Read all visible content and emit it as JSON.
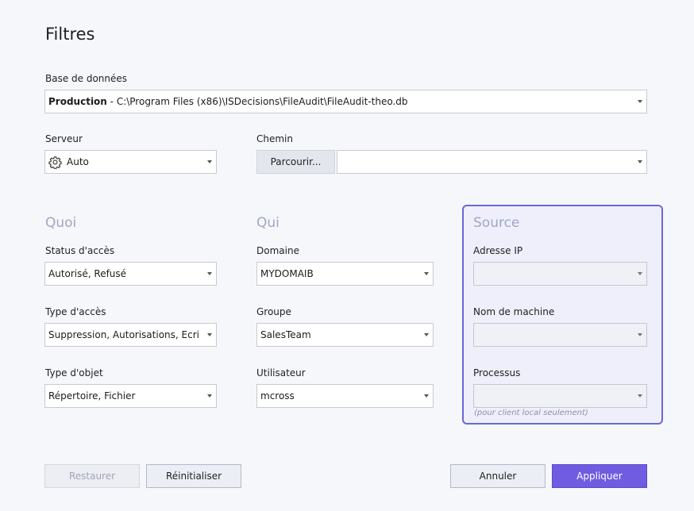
{
  "title": "Filtres",
  "database": {
    "label": "Base de données",
    "name": "Production",
    "separator": " - ",
    "path": "C:\\Program Files (x86)\\ISDecisions\\FileAudit\\FileAudit-theo.db"
  },
  "server": {
    "label": "Serveur",
    "value": "Auto",
    "icon": "gear-icon"
  },
  "path_field": {
    "label": "Chemin",
    "browse_label": "Parcourir...",
    "value": ""
  },
  "quoi": {
    "heading": "Quoi",
    "access_status": {
      "label": "Status d'accès",
      "value": "Autorisé, Refusé"
    },
    "access_type": {
      "label": "Type d'accès",
      "value": "Suppression, Autorisations, Ecri..."
    },
    "object_type": {
      "label": "Type d'objet",
      "value": "Répertoire, Fichier"
    }
  },
  "qui": {
    "heading": "Qui",
    "domain": {
      "label": "Domaine",
      "value": "MYDOMAIB"
    },
    "group": {
      "label": "Groupe",
      "value": "SalesTeam"
    },
    "user": {
      "label": "Utilisateur",
      "value": "mcross"
    }
  },
  "source": {
    "heading": "Source",
    "ip": {
      "label": "Adresse IP",
      "value": ""
    },
    "machine": {
      "label": "Nom de machine",
      "value": ""
    },
    "process": {
      "label": "Processus",
      "value": "",
      "hint": "(pour client local seulement)"
    }
  },
  "buttons": {
    "restore": "Restaurer",
    "reset": "Réinitialiser",
    "cancel": "Annuler",
    "apply": "Appliquer"
  },
  "colors": {
    "accent": "#6f5ce0",
    "source_border": "#6a68d6",
    "section_heading": "#a0a7c2"
  }
}
